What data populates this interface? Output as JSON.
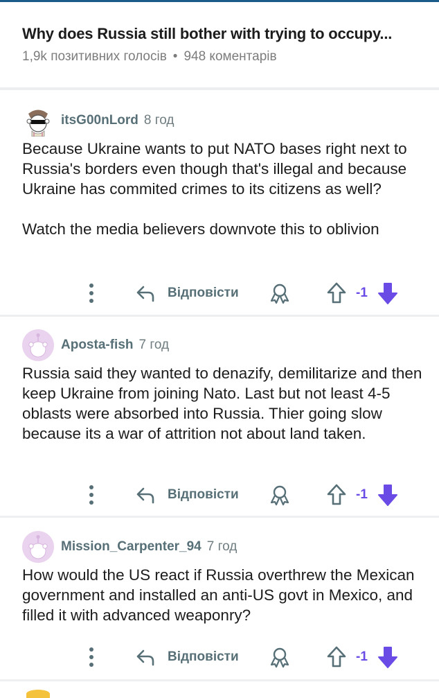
{
  "post": {
    "title": "Why does Russia still bother with trying to occupy...",
    "upvotes": "1,9k позитивних голосів",
    "separator": "•",
    "comments_count": "948 коментарів"
  },
  "labels": {
    "reply": "Відповісти"
  },
  "colors": {
    "accent": "#6b4be5",
    "meta_gray": "#576f76",
    "divider": "#edeff1"
  },
  "icons": {
    "more": "more-vertical-icon",
    "reply": "reply-arrow-icon",
    "award": "award-icon",
    "upvote": "upvote-arrow-icon",
    "downvote": "downvote-arrow-icon"
  },
  "comments": [
    {
      "username": "itsG00nLord",
      "time": "8 год",
      "avatar": "sunglasses-snoo-avatar",
      "paragraphs": [
        "Because Ukraine wants to put NATO bases right next to Russia's borders even though that's illegal and because Ukraine has commited crimes to its citizens as well?",
        "Watch the media believers downvote this to oblivion"
      ],
      "score": "-1"
    },
    {
      "username": "Aposta-fish",
      "time": "7 год",
      "avatar": "default-snoo-avatar",
      "paragraphs": [
        "Russia said they wanted to denazify, demilitarize and then keep Ukraine from joining Nato. Last but not least 4-5 oblasts were absorbed into Russia. Thier going slow because its a war of attrition not about land taken."
      ],
      "score": "-1"
    },
    {
      "username": "Mission_Carpenter_94",
      "time": "7 год",
      "avatar": "default-snoo-avatar",
      "paragraphs": [
        "How would the US react if Russia overthrew the Mexican government and installed an anti-US govt in Mexico, and filled it with advanced weaponry?"
      ],
      "score": "-1"
    }
  ]
}
